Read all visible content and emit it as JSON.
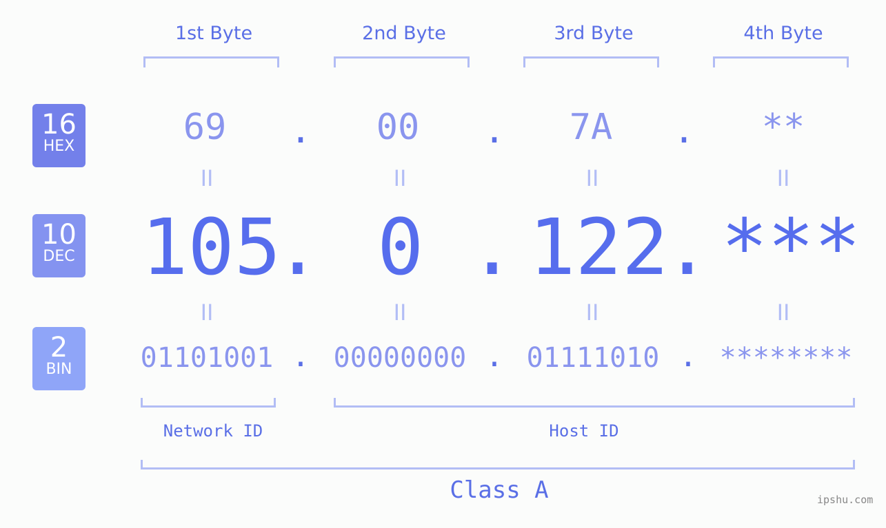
{
  "byte_headers": [
    "1st Byte",
    "2nd Byte",
    "3rd Byte",
    "4th Byte"
  ],
  "badges": [
    {
      "base": "16",
      "name": "HEX",
      "color": "#7380ea"
    },
    {
      "base": "10",
      "name": "DEC",
      "color": "#8493f0"
    },
    {
      "base": "2",
      "name": "BIN",
      "color": "#8fa5f8"
    }
  ],
  "hex": [
    "69",
    "00",
    "7A",
    "**"
  ],
  "dec": [
    "105",
    "0",
    "122",
    "***"
  ],
  "bin": [
    "01101001",
    "00000000",
    "01111010",
    "********"
  ],
  "separator": ".",
  "equals": "II",
  "network_id_label": "Network ID",
  "host_id_label": "Host ID",
  "class_label": "Class A",
  "watermark": "ipshu.com",
  "colors": {
    "accent": "#566ded",
    "light": "#8a95ee",
    "bracket": "#b2bdf5"
  }
}
